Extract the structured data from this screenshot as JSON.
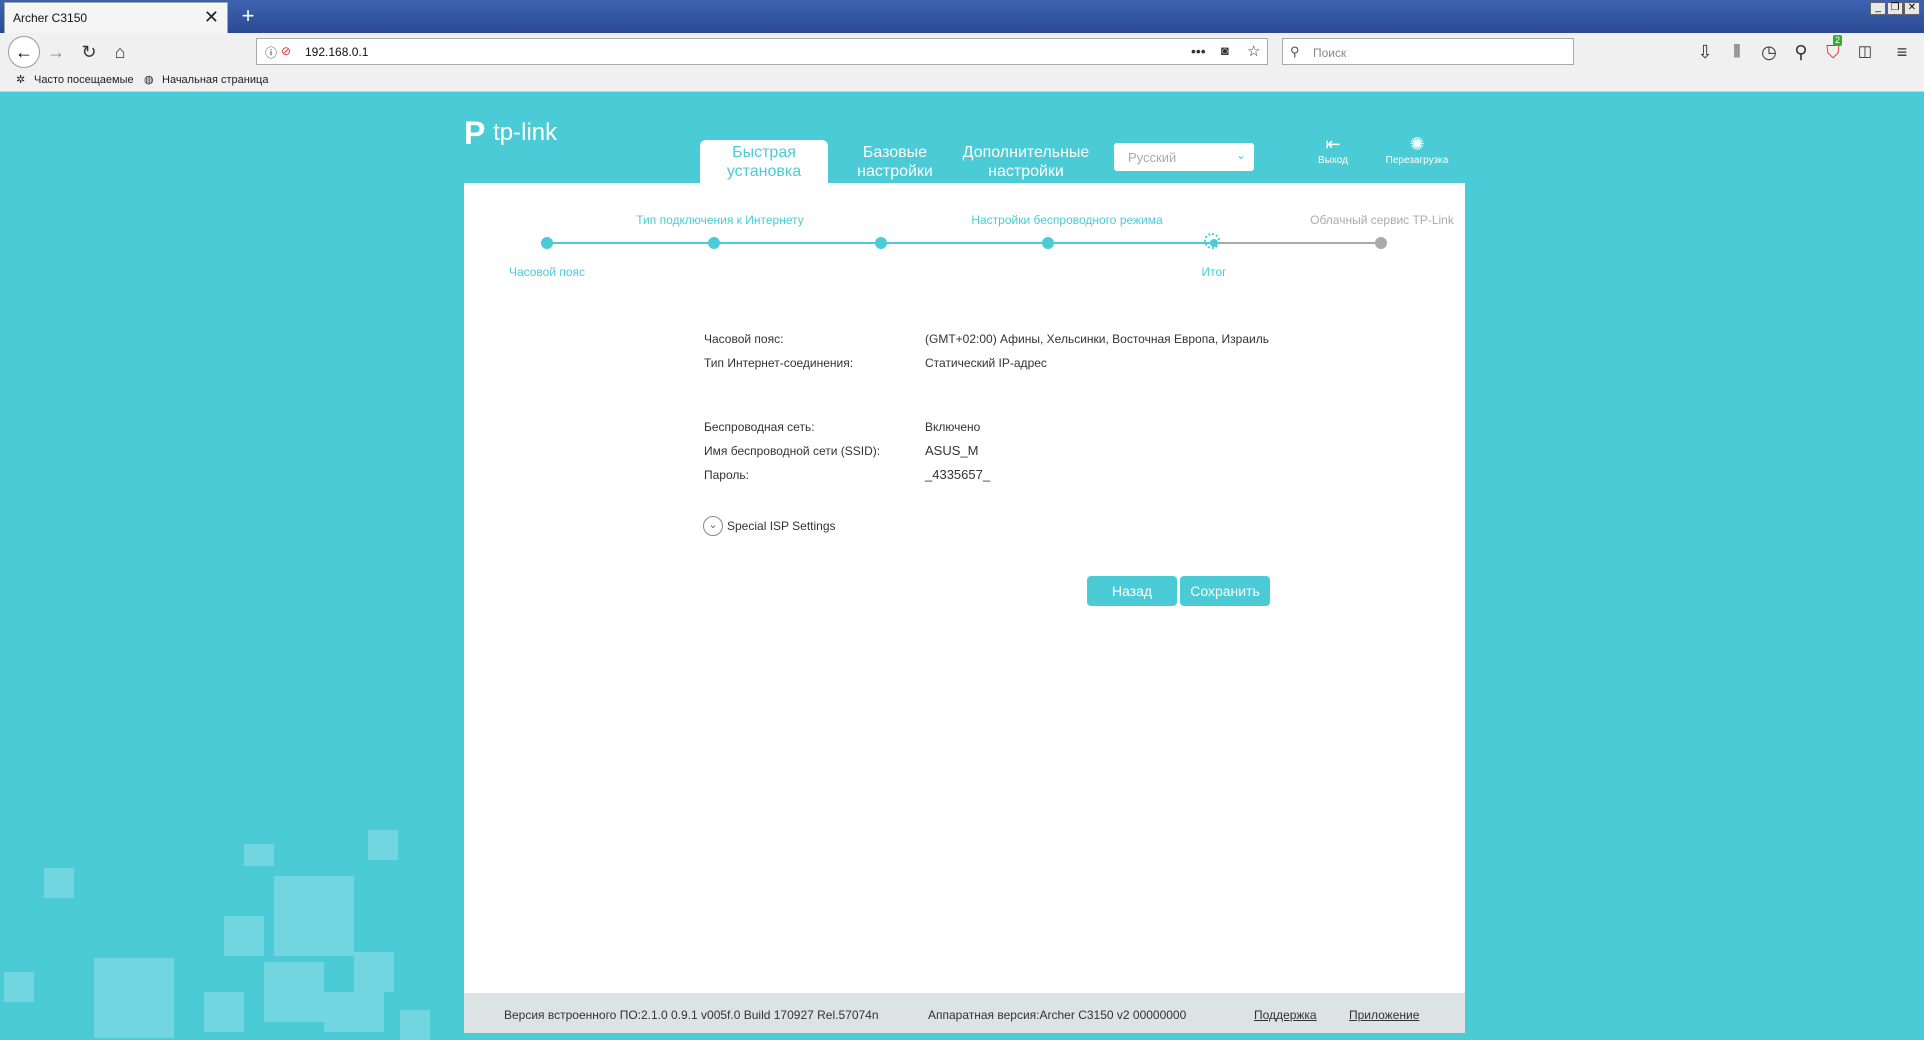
{
  "browser": {
    "tab_title": "Archer C3150",
    "new_tab": "+",
    "url": "192.168.0.1",
    "search_placeholder": "Поиск",
    "bookmarks": [
      "Часто посещаемые",
      "Начальная страница"
    ],
    "badge_count": "2"
  },
  "header": {
    "logo": "tp-link",
    "tabs": [
      {
        "line1": "Быстрая",
        "line2": "установка"
      },
      {
        "line1": "Базовые",
        "line2": "настройки"
      },
      {
        "line1": "Дополнительные",
        "line2": "настройки"
      }
    ],
    "language": "Русский",
    "logout_label": "Выход",
    "reboot_label": "Перезагрузка"
  },
  "steps": [
    {
      "label": "Часовой пояс",
      "state": "done"
    },
    {
      "label": "Тип подключения к Интернету",
      "state": "done"
    },
    {
      "label": "",
      "state": "done"
    },
    {
      "label": "Настройки беспроводного режима",
      "state": "done"
    },
    {
      "label": "Итог",
      "state": "current"
    },
    {
      "label": "Облачный сервис TP-Link",
      "state": "pending"
    }
  ],
  "summary": {
    "timezone_label": "Часовой пояс:",
    "timezone_value": "(GMT+02:00) Афины, Хельсинки, Восточная Европа, Израиль",
    "conn_label": "Тип Интернет-соединения:",
    "conn_value": "Статический IP-адрес",
    "wireless_label": "Беспроводная сеть:",
    "wireless_value": "Включено",
    "ssid_label": "Имя беспроводной сети (SSID):",
    "ssid_value": "ASUS_M",
    "password_label": "Пароль:",
    "password_value": "_4335657_",
    "isp_toggle": "Special ISP Settings"
  },
  "buttons": {
    "back": "Назад",
    "save": "Сохранить"
  },
  "footer": {
    "firmware": "Версия встроенного ПО:2.1.0 0.9.1 v005f.0 Build 170927 Rel.57074n",
    "hardware": "Аппаратная версия:Archer C3150 v2 00000000",
    "support": "Поддержка",
    "app": "Приложение"
  },
  "colors": {
    "accent": "#4acbd6",
    "pending": "#aaaaaa",
    "chrome_title": "#2b4a93"
  }
}
